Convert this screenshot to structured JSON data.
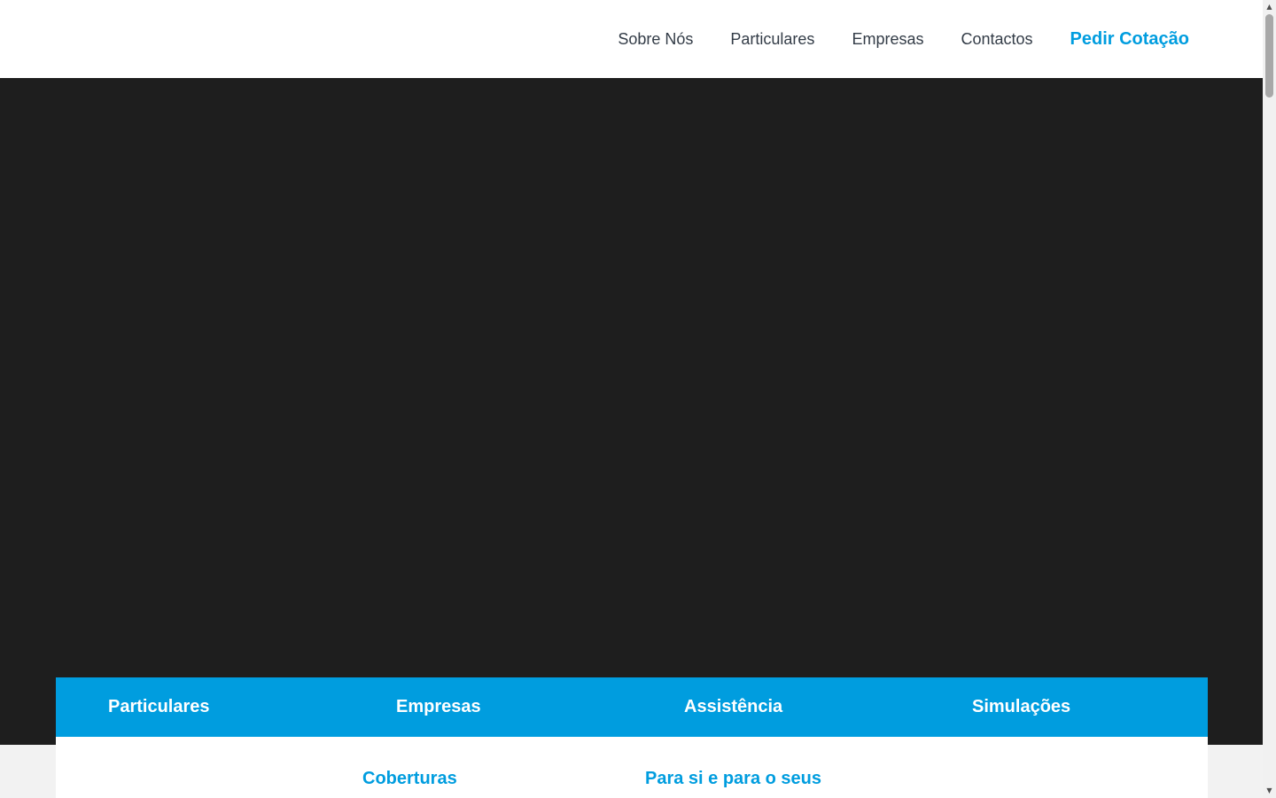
{
  "nav": {
    "items": [
      {
        "label": "Sobre Nós"
      },
      {
        "label": "Particulares"
      },
      {
        "label": "Empresas"
      },
      {
        "label": "Contactos"
      }
    ],
    "cta_label": "Pedir Cotação"
  },
  "categories": [
    {
      "label": "Particulares"
    },
    {
      "label": "Empresas"
    },
    {
      "label": "Assistência"
    },
    {
      "label": "Simulações"
    }
  ],
  "panel": {
    "links": [
      {
        "label": "Coberturas"
      },
      {
        "label": "Para si e para o seus"
      }
    ]
  },
  "colors": {
    "accent": "#009ddf",
    "hero_bg": "#1e1e1e",
    "nav_text": "#333c47"
  },
  "icons": {
    "scroll_up": "triangle-up",
    "scroll_down": "triangle-down"
  }
}
